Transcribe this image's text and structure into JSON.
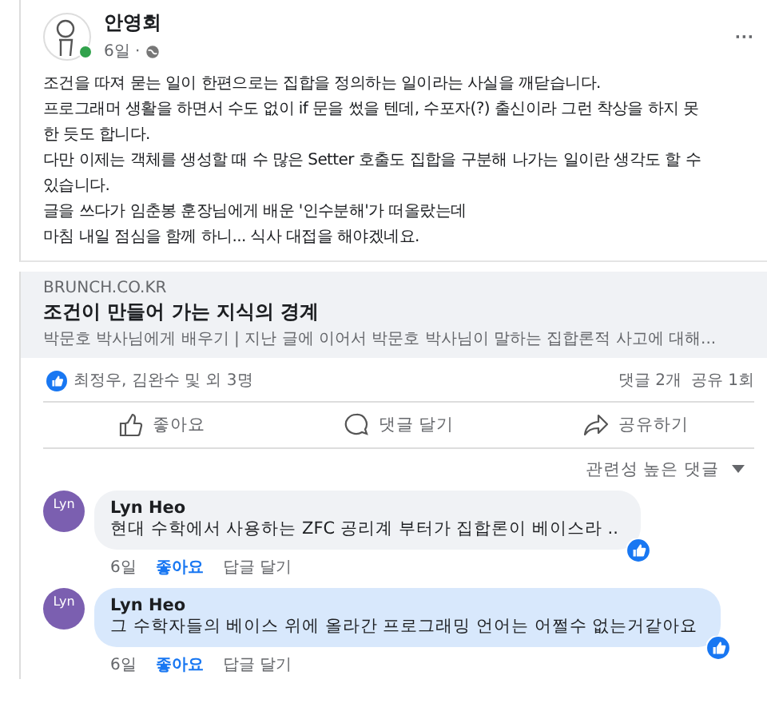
{
  "post": {
    "author": "안영회",
    "time": "6일 ·",
    "online": true,
    "more": "···",
    "lines": [
      "조건을 따져 묻는 일이 한편으로는 집합을 정의하는 일이라는 사실을 깨닫습니다.",
      "프로그래머 생활을 하면서 수도 없이 if 문을 썼을 텐데, 수포자(?) 출신이라 그런 착상을 하지 못",
      "한 듯도 합니다.",
      "다만 이제는 객체를 생성할 때 수 많은 Setter 호출도 집합을 구분해 나가는 일이란 생각도 할 수",
      "있습니다.",
      "글을 쓰다가 임춘봉 훈장님에게 배운 '인수분해'가 떠올랐는데",
      "마침 내일 점심을 함께 하니... 식사 대접을 해야겠네요."
    ]
  },
  "link": {
    "domain": "BRUNCH.CO.KR",
    "title": "조건이 만들어 가는 지식의 경계",
    "description": "박문호 박사님에게 배우기 | 지난 글에 이어서 박문호 박사님이 말하는 집합론적 사고에 대해..."
  },
  "reactions": {
    "names": "최정우, 김완수 및 외 3명",
    "comments": "댓글 2개",
    "shares": "공유 1회"
  },
  "actions": [
    {
      "kind": "like",
      "label": "좋아요"
    },
    {
      "kind": "comment",
      "label": "댓글 달기"
    },
    {
      "kind": "share",
      "label": "공유하기"
    }
  ],
  "sort": "관련성 높은 댓글",
  "comments": [
    {
      "avatar": "Lyn",
      "author": "Lyn Heo",
      "text": "현대 수학에서 사용하는 ZFC 공리계 부터가 집합론이 베이스라 ..",
      "highlighted": false,
      "time": "6일",
      "like": "좋아요",
      "liked": true,
      "reply": "답글 달기"
    },
    {
      "avatar": "Lyn",
      "author": "Lyn Heo",
      "text": "그 수학자들의 베이스 위에 올라간 프로그래밍 언어는 어쩔수 없는거같아요",
      "highlighted": true,
      "time": "6일",
      "like": "좋아요",
      "liked": true,
      "reply": "답글 달기"
    }
  ]
}
